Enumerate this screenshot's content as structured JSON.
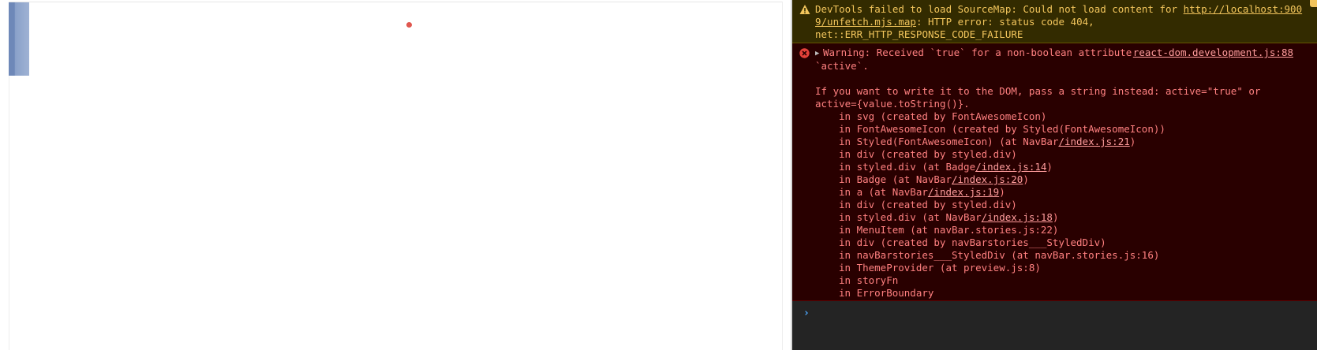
{
  "console": {
    "warning": {
      "prefix": "DevTools failed to load SourceMap: Could not load content for ",
      "url": "http://localhost:9009/unfetch.mjs.map",
      "url_line1": "http://localhost:900",
      "url_line2": "9/unfetch.mjs.map",
      "suffix": ": HTTP error: status code 404,",
      "line3": "net::ERR_HTTP_RESPONSE_CODE_FAILURE",
      "color": "#f2c55c"
    },
    "error": {
      "first_line": "Warning: Received `true` for a non-boolean attribute",
      "source": "react-dom.development.js:88",
      "second_line": "`active`.",
      "advice_line1": "If you want to write it to the DOM, pass a string instead: active=\"true\" or",
      "advice_line2": "active={value.toString()}.",
      "color": "#ff8080",
      "stack": [
        {
          "text": "in svg (created by FontAwesomeIcon)",
          "link": ""
        },
        {
          "text": "in FontAwesomeIcon (created by Styled(FontAwesomeIcon))",
          "link": ""
        },
        {
          "text": "in Styled(FontAwesomeIcon) (at NavBar",
          "link": "/index.js:21",
          "after": ")"
        },
        {
          "text": "in div (created by styled.div)",
          "link": ""
        },
        {
          "text": "in styled.div (at Badge",
          "link": "/index.js:14",
          "after": ")"
        },
        {
          "text": "in Badge (at NavBar",
          "link": "/index.js:20",
          "after": ")"
        },
        {
          "text": "in a (at NavBar",
          "link": "/index.js:19",
          "after": ")"
        },
        {
          "text": "in div (created by styled.div)",
          "link": ""
        },
        {
          "text": "in styled.div (at NavBar",
          "link": "/index.js:18",
          "after": ")"
        },
        {
          "text": "in MenuItem (at navBar.stories.js:22)",
          "link": ""
        },
        {
          "text": "in div (created by navBarstories___StyledDiv)",
          "link": ""
        },
        {
          "text": "in navBarstories___StyledDiv (at navBar.stories.js:16)",
          "link": ""
        },
        {
          "text": "in ThemeProvider (at preview.js:8)",
          "link": ""
        },
        {
          "text": "in storyFn",
          "link": ""
        },
        {
          "text": "in ErrorBoundary",
          "link": ""
        }
      ]
    },
    "prompt": {
      "symbol": "›",
      "value": ""
    }
  },
  "icons": {
    "warning": "warning-triangle-icon",
    "error": "error-circle-icon",
    "expand": "expand-triangle-icon",
    "prompt": "prompt-chevron-icon"
  }
}
